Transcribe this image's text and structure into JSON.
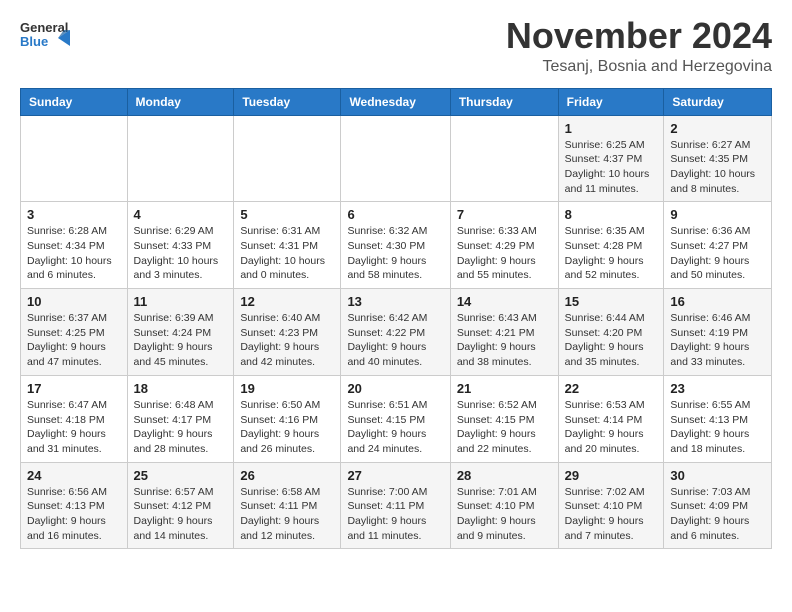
{
  "header": {
    "logo_general": "General",
    "logo_blue": "Blue",
    "month": "November 2024",
    "location": "Tesanj, Bosnia and Herzegovina"
  },
  "weekdays": [
    "Sunday",
    "Monday",
    "Tuesday",
    "Wednesday",
    "Thursday",
    "Friday",
    "Saturday"
  ],
  "weeks": [
    [
      {
        "day": "",
        "info": ""
      },
      {
        "day": "",
        "info": ""
      },
      {
        "day": "",
        "info": ""
      },
      {
        "day": "",
        "info": ""
      },
      {
        "day": "",
        "info": ""
      },
      {
        "day": "1",
        "info": "Sunrise: 6:25 AM\nSunset: 4:37 PM\nDaylight: 10 hours and 11 minutes."
      },
      {
        "day": "2",
        "info": "Sunrise: 6:27 AM\nSunset: 4:35 PM\nDaylight: 10 hours and 8 minutes."
      }
    ],
    [
      {
        "day": "3",
        "info": "Sunrise: 6:28 AM\nSunset: 4:34 PM\nDaylight: 10 hours and 6 minutes."
      },
      {
        "day": "4",
        "info": "Sunrise: 6:29 AM\nSunset: 4:33 PM\nDaylight: 10 hours and 3 minutes."
      },
      {
        "day": "5",
        "info": "Sunrise: 6:31 AM\nSunset: 4:31 PM\nDaylight: 10 hours and 0 minutes."
      },
      {
        "day": "6",
        "info": "Sunrise: 6:32 AM\nSunset: 4:30 PM\nDaylight: 9 hours and 58 minutes."
      },
      {
        "day": "7",
        "info": "Sunrise: 6:33 AM\nSunset: 4:29 PM\nDaylight: 9 hours and 55 minutes."
      },
      {
        "day": "8",
        "info": "Sunrise: 6:35 AM\nSunset: 4:28 PM\nDaylight: 9 hours and 52 minutes."
      },
      {
        "day": "9",
        "info": "Sunrise: 6:36 AM\nSunset: 4:27 PM\nDaylight: 9 hours and 50 minutes."
      }
    ],
    [
      {
        "day": "10",
        "info": "Sunrise: 6:37 AM\nSunset: 4:25 PM\nDaylight: 9 hours and 47 minutes."
      },
      {
        "day": "11",
        "info": "Sunrise: 6:39 AM\nSunset: 4:24 PM\nDaylight: 9 hours and 45 minutes."
      },
      {
        "day": "12",
        "info": "Sunrise: 6:40 AM\nSunset: 4:23 PM\nDaylight: 9 hours and 42 minutes."
      },
      {
        "day": "13",
        "info": "Sunrise: 6:42 AM\nSunset: 4:22 PM\nDaylight: 9 hours and 40 minutes."
      },
      {
        "day": "14",
        "info": "Sunrise: 6:43 AM\nSunset: 4:21 PM\nDaylight: 9 hours and 38 minutes."
      },
      {
        "day": "15",
        "info": "Sunrise: 6:44 AM\nSunset: 4:20 PM\nDaylight: 9 hours and 35 minutes."
      },
      {
        "day": "16",
        "info": "Sunrise: 6:46 AM\nSunset: 4:19 PM\nDaylight: 9 hours and 33 minutes."
      }
    ],
    [
      {
        "day": "17",
        "info": "Sunrise: 6:47 AM\nSunset: 4:18 PM\nDaylight: 9 hours and 31 minutes."
      },
      {
        "day": "18",
        "info": "Sunrise: 6:48 AM\nSunset: 4:17 PM\nDaylight: 9 hours and 28 minutes."
      },
      {
        "day": "19",
        "info": "Sunrise: 6:50 AM\nSunset: 4:16 PM\nDaylight: 9 hours and 26 minutes."
      },
      {
        "day": "20",
        "info": "Sunrise: 6:51 AM\nSunset: 4:15 PM\nDaylight: 9 hours and 24 minutes."
      },
      {
        "day": "21",
        "info": "Sunrise: 6:52 AM\nSunset: 4:15 PM\nDaylight: 9 hours and 22 minutes."
      },
      {
        "day": "22",
        "info": "Sunrise: 6:53 AM\nSunset: 4:14 PM\nDaylight: 9 hours and 20 minutes."
      },
      {
        "day": "23",
        "info": "Sunrise: 6:55 AM\nSunset: 4:13 PM\nDaylight: 9 hours and 18 minutes."
      }
    ],
    [
      {
        "day": "24",
        "info": "Sunrise: 6:56 AM\nSunset: 4:13 PM\nDaylight: 9 hours and 16 minutes."
      },
      {
        "day": "25",
        "info": "Sunrise: 6:57 AM\nSunset: 4:12 PM\nDaylight: 9 hours and 14 minutes."
      },
      {
        "day": "26",
        "info": "Sunrise: 6:58 AM\nSunset: 4:11 PM\nDaylight: 9 hours and 12 minutes."
      },
      {
        "day": "27",
        "info": "Sunrise: 7:00 AM\nSunset: 4:11 PM\nDaylight: 9 hours and 11 minutes."
      },
      {
        "day": "28",
        "info": "Sunrise: 7:01 AM\nSunset: 4:10 PM\nDaylight: 9 hours and 9 minutes."
      },
      {
        "day": "29",
        "info": "Sunrise: 7:02 AM\nSunset: 4:10 PM\nDaylight: 9 hours and 7 minutes."
      },
      {
        "day": "30",
        "info": "Sunrise: 7:03 AM\nSunset: 4:09 PM\nDaylight: 9 hours and 6 minutes."
      }
    ]
  ]
}
